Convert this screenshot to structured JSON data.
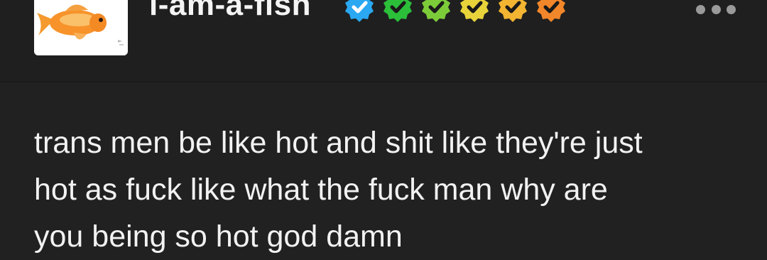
{
  "post": {
    "username": "i-am-a-fish",
    "avatar": "goldfish-avatar",
    "badges": [
      {
        "icon": "verified-badge-icon",
        "color": "#2aa8f2"
      },
      {
        "icon": "verified-badge-icon",
        "color": "#2bbf3a"
      },
      {
        "icon": "verified-badge-icon",
        "color": "#7ccc3a"
      },
      {
        "icon": "verified-badge-icon",
        "color": "#e8d43a"
      },
      {
        "icon": "verified-badge-icon",
        "color": "#f2b431"
      },
      {
        "icon": "verified-badge-icon",
        "color": "#f2862a"
      }
    ],
    "more_icon": "more-options-icon",
    "body_text": "trans men be like hot and shit like they're just\nhot as fuck like what the fuck man why are\nyou being so hot god damn"
  },
  "colors": {
    "background": "#212121",
    "text": "#f2f2f2"
  }
}
